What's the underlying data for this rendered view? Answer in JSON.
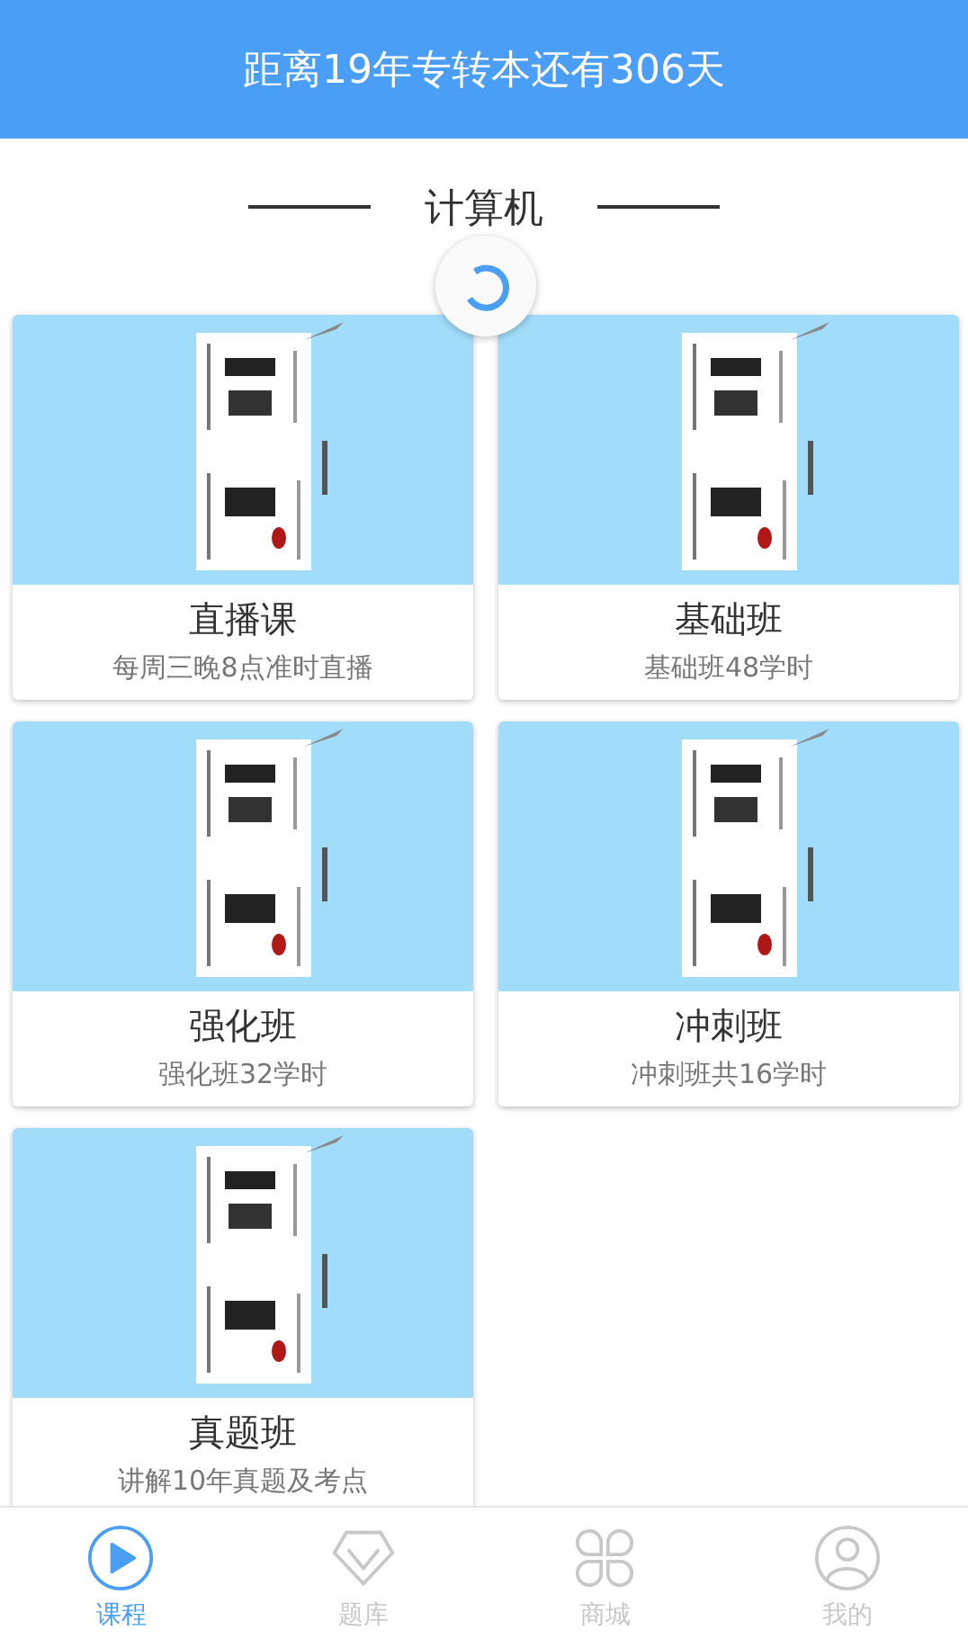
{
  "header": {
    "title": "距离19年专转本还有306天"
  },
  "section": {
    "title": "计算机",
    "loading": true
  },
  "courses": [
    {
      "kind": "picture",
      "name": "直播课",
      "desc": "每周三晚8点准时直播"
    },
    {
      "kind": "picture",
      "name": "基础班",
      "desc": "基础班48学时"
    },
    {
      "kind": "picture",
      "name": "强化班",
      "desc": "强化班32学时"
    },
    {
      "kind": "picture",
      "name": "冲刺班",
      "desc": "冲刺班共16学时"
    },
    {
      "kind": "picture",
      "name": "真题班",
      "desc": "讲解10年真题及考点"
    }
  ],
  "tabs": [
    {
      "label": "课程",
      "kind": "play",
      "selected": true
    },
    {
      "label": "题库",
      "kind": "diamond",
      "selected": false
    },
    {
      "label": "商城",
      "kind": "clover",
      "selected": false
    },
    {
      "label": "我的",
      "kind": "person",
      "selected": false
    }
  ]
}
